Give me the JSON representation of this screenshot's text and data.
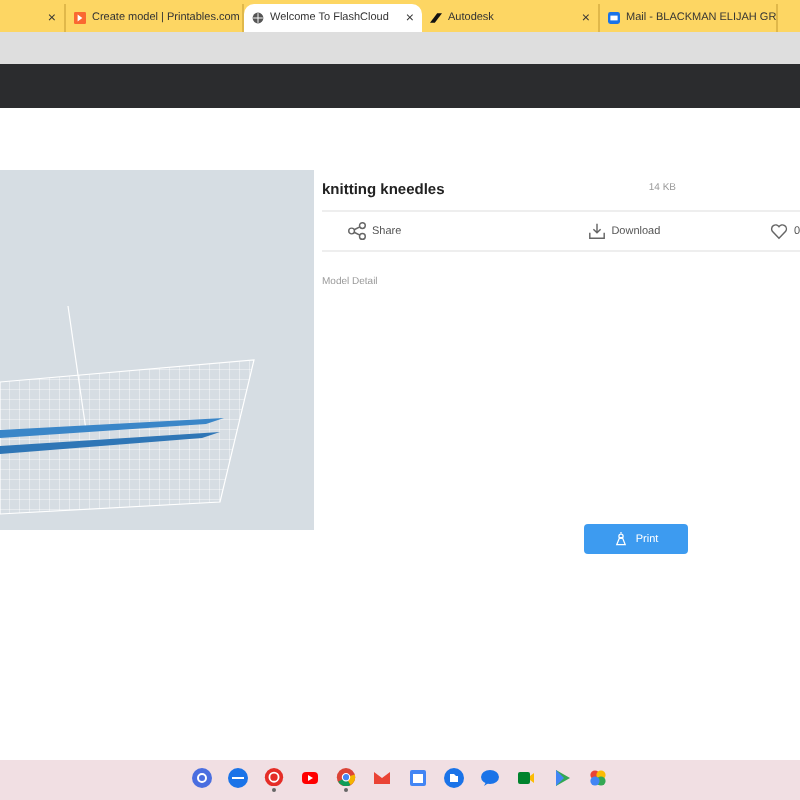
{
  "browser": {
    "tabs": [
      {
        "selected": false,
        "kind": "blank"
      },
      {
        "title": "Create model | Printables.com",
        "selected": false,
        "kind": "printables"
      },
      {
        "title": "Welcome To FlashCloud",
        "selected": true,
        "kind": "globe"
      },
      {
        "title": "Autodesk",
        "selected": false,
        "kind": "autodesk"
      },
      {
        "title": "Mail - BLACKMAN ELIJAH GR",
        "selected": false,
        "kind": "mail"
      }
    ],
    "close_glyph": "×"
  },
  "model": {
    "kind": "picture",
    "title": "knitting kneedles",
    "size": "14 KB",
    "actions": [
      {
        "kind": "share",
        "label": "Share"
      },
      {
        "kind": "download",
        "label": "Download"
      },
      {
        "kind": "like",
        "label": "0"
      }
    ],
    "detail_label": "Model Detail",
    "print_label": "Print"
  },
  "shelf": {
    "apps": [
      {
        "kind": "launcher",
        "running": false
      },
      {
        "kind": "keys",
        "running": false
      },
      {
        "kind": "music",
        "running": true
      },
      {
        "kind": "youtube",
        "running": false
      },
      {
        "kind": "chrome",
        "running": true
      },
      {
        "kind": "gmail",
        "running": false
      },
      {
        "kind": "calendar",
        "running": false
      },
      {
        "kind": "files",
        "running": false
      },
      {
        "kind": "chat",
        "running": false
      },
      {
        "kind": "meet",
        "running": false
      },
      {
        "kind": "play",
        "running": false
      },
      {
        "kind": "photos",
        "running": false
      }
    ]
  }
}
